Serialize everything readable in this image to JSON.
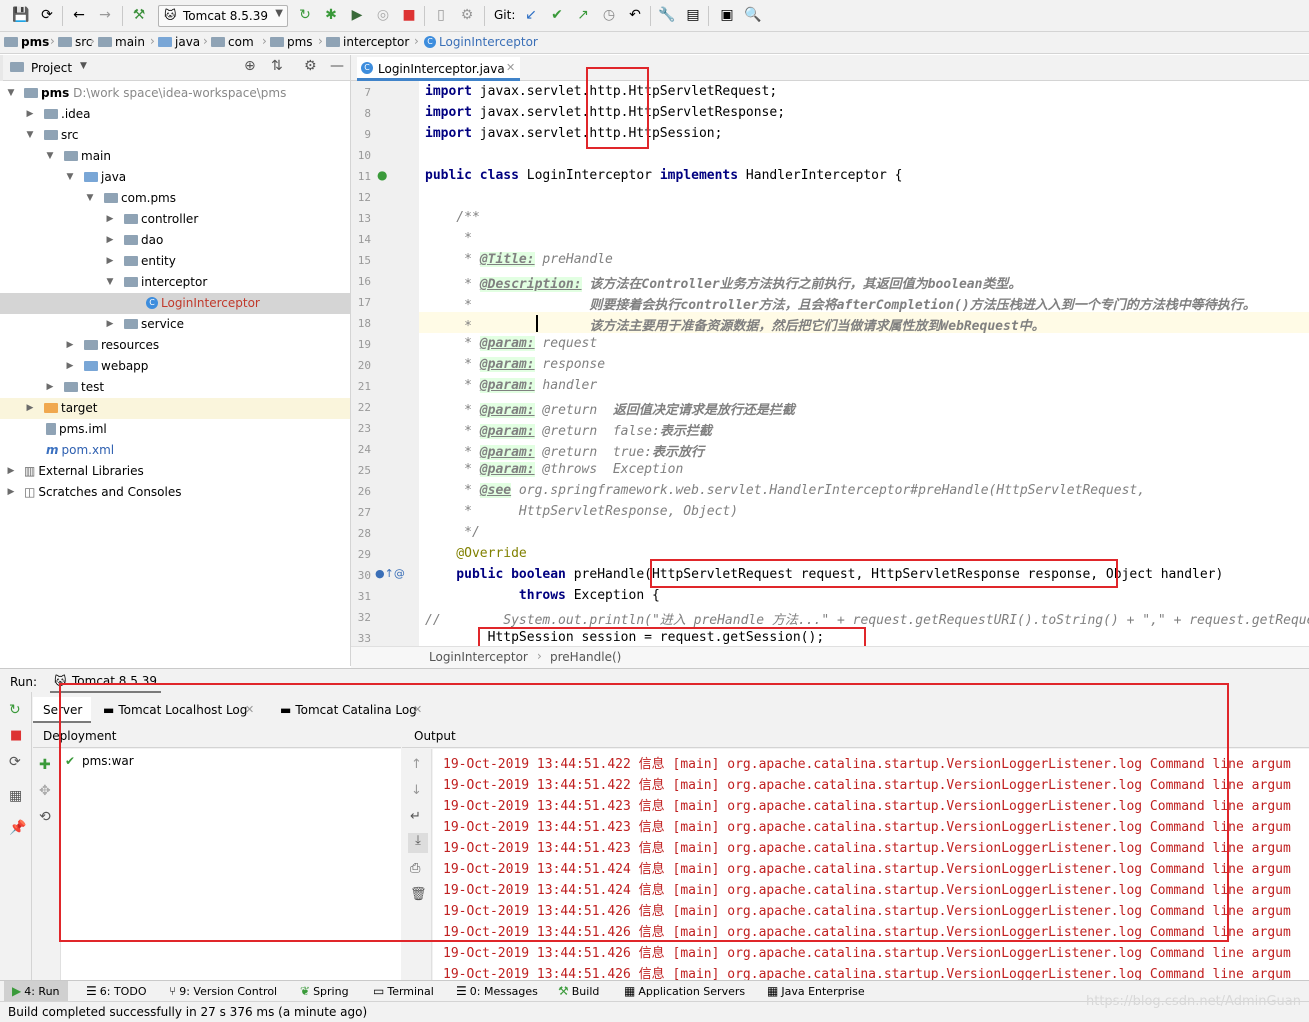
{
  "toolbar": {
    "run_config": "Tomcat 8.5.39",
    "git_label": "Git:"
  },
  "breadcrumb": [
    "pms",
    "src",
    "main",
    "java",
    "com",
    "pms",
    "interceptor",
    "LoginInterceptor"
  ],
  "project_panel": {
    "title": "Project",
    "tree": [
      {
        "label": "pms",
        "extra": "D:\\work space\\idea-workspace\\pms"
      },
      {
        "label": ".idea"
      },
      {
        "label": "src"
      },
      {
        "label": "main"
      },
      {
        "label": "java"
      },
      {
        "label": "com.pms"
      },
      {
        "label": "controller"
      },
      {
        "label": "dao"
      },
      {
        "label": "entity"
      },
      {
        "label": "interceptor"
      },
      {
        "label": "LoginInterceptor"
      },
      {
        "label": "service"
      },
      {
        "label": "resources"
      },
      {
        "label": "webapp"
      },
      {
        "label": "test"
      },
      {
        "label": "target"
      },
      {
        "label": "pms.iml"
      },
      {
        "label": "pom.xml"
      },
      {
        "label": "External Libraries"
      },
      {
        "label": "Scratches and Consoles"
      }
    ]
  },
  "editor": {
    "tab_label": "LoginInterceptor.java",
    "line_numbers": [
      "7",
      "8",
      "9",
      "10",
      "11",
      "12",
      "13",
      "14",
      "15",
      "16",
      "17",
      "18",
      "19",
      "20",
      "21",
      "22",
      "23",
      "24",
      "25",
      "26",
      "27",
      "28",
      "29",
      "30",
      "31",
      "32",
      "33"
    ],
    "code": {
      "l7a": "import",
      "l7b": " javax.servlet.http.HttpServletRequest;",
      "l8a": "import",
      "l8b": " javax.servlet.http.HttpServletResponse;",
      "l9a": "import",
      "l9b": " javax.servlet.http.HttpSession;",
      "l11a": "public class",
      "l11b": " LoginInterceptor ",
      "l11c": "implements",
      "l11d": " HandlerInterceptor {",
      "l13": "    /**",
      "l14": "     *",
      "l15a": "     * ",
      "l15tag": "@Title:",
      "l15b": " preHandle",
      "l16a": "     * ",
      "l16tag": "@Description:",
      "l16b": " 该方法在Controller业务方法执行之前执行，其返回值为boolean类型。",
      "l17a": "     *               ",
      "l17b": "则要接着会执行controller方法，且会将afterCompletion()方法压栈进入入到一个专门的方法栈中等待执行。",
      "l18a": "     *               ",
      "l18b": "该方法主要用于准备资源数据，然后把它们当做请求属性放到WebRequest中。",
      "l19a": "     * ",
      "l19tag": "@param:",
      "l19b": " request",
      "l20a": "     * ",
      "l20tag": "@param:",
      "l20b": " response",
      "l21a": "     * ",
      "l21tag": "@param:",
      "l21b": " handler",
      "l22a": "     * ",
      "l22tag": "@param:",
      "l22b": " @return  ",
      "l22c": "返回值决定请求是放行还是拦截",
      "l23a": "     * ",
      "l23tag": "@param:",
      "l23b": " @return  false:",
      "l23c": "表示拦截",
      "l24a": "     * ",
      "l24tag": "@param:",
      "l24b": " @return  true:",
      "l24c": "表示放行",
      "l25a": "     * ",
      "l25tag": "@param:",
      "l25b": " @throws  Exception",
      "l26a": "     * ",
      "l26tag": "@see",
      "l26b": " org.springframework.web.servlet.HandlerInterceptor#preHandle(HttpServletRequest,",
      "l27": "     *      HttpServletResponse, Object)",
      "l28": "     */",
      "l29": "    @Override",
      "l30a": "    public boolean",
      "l30b": " preHandle(HttpServletRequest request, HttpServletResponse response, Object handler)",
      "l31a": "            throws",
      "l31b": " Exception {",
      "l32a": "//",
      "l32b": "        System.out.println(\"进入 preHandle 方法...\" + request.getRequestURI().toString() + \",\" + request.getReque",
      "l33": "        HttpSession session = request.getSession();"
    },
    "breadcrumb": [
      "LoginInterceptor",
      "preHandle()"
    ]
  },
  "run_panel": {
    "label": "Run:",
    "config": "Tomcat 8.5.39",
    "tabs": [
      "Server",
      "Tomcat Localhost Log",
      "Tomcat Catalina Log"
    ],
    "deployment_header": "Deployment",
    "deployment_items": [
      "pms:war"
    ],
    "output_header": "Output",
    "output_lines": [
      "19-Oct-2019 13:44:51.422 信息 [main] org.apache.catalina.startup.VersionLoggerListener.log Command line argum",
      "19-Oct-2019 13:44:51.422 信息 [main] org.apache.catalina.startup.VersionLoggerListener.log Command line argum",
      "19-Oct-2019 13:44:51.423 信息 [main] org.apache.catalina.startup.VersionLoggerListener.log Command line argum",
      "19-Oct-2019 13:44:51.423 信息 [main] org.apache.catalina.startup.VersionLoggerListener.log Command line argum",
      "19-Oct-2019 13:44:51.423 信息 [main] org.apache.catalina.startup.VersionLoggerListener.log Command line argum",
      "19-Oct-2019 13:44:51.424 信息 [main] org.apache.catalina.startup.VersionLoggerListener.log Command line argum",
      "19-Oct-2019 13:44:51.424 信息 [main] org.apache.catalina.startup.VersionLoggerListener.log Command line argum",
      "19-Oct-2019 13:44:51.426 信息 [main] org.apache.catalina.startup.VersionLoggerListener.log Command line argum",
      "19-Oct-2019 13:44:51.426 信息 [main] org.apache.catalina.startup.VersionLoggerListener.log Command line argum",
      "19-Oct-2019 13:44:51.426 信息 [main] org.apache.catalina.startup.VersionLoggerListener.log Command line argum",
      "19-Oct-2019 13:44:51.426 信息 [main] org.apache.catalina.startup.VersionLoggerListener.log Command line argum"
    ]
  },
  "bottom_tabs": [
    "4: Run",
    "6: TODO",
    "9: Version Control",
    "Spring",
    "Terminal",
    "0: Messages",
    "Build",
    "Application Servers",
    "Java Enterprise"
  ],
  "status": "Build completed successfully in 27 s 376 ms (a minute ago)",
  "watermark": "https://blog.csdn.net/AdminGuan",
  "colors": {
    "highlight_box": "#e0262a",
    "keyword": "#000080",
    "output_text": "#c02020",
    "selection": "#d5d5d5"
  }
}
